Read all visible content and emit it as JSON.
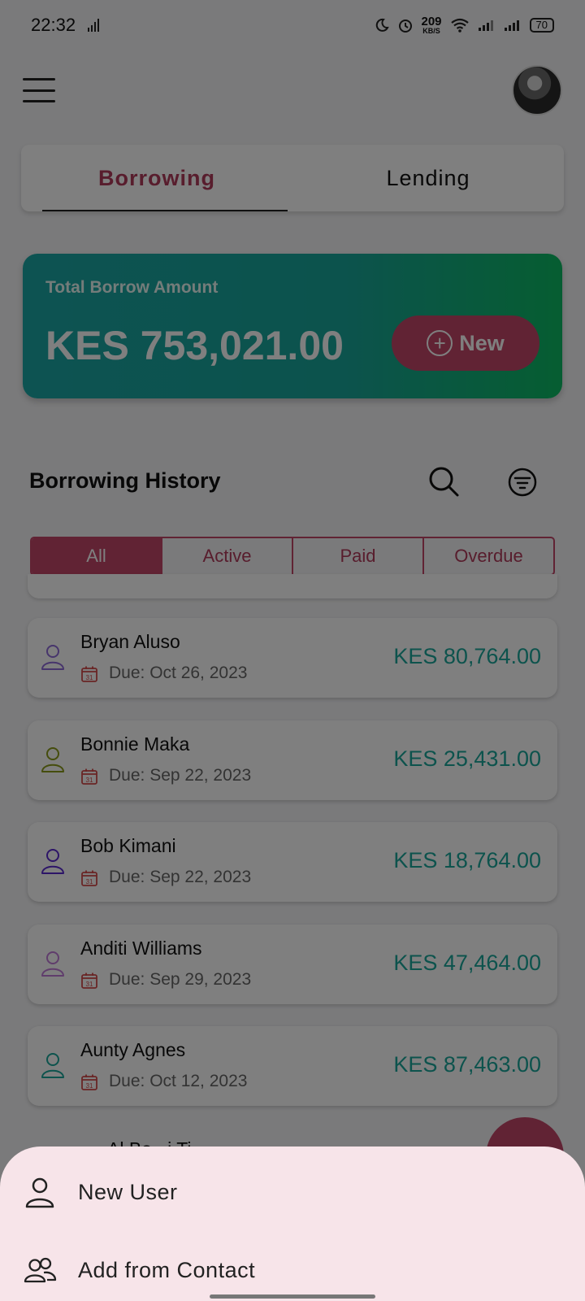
{
  "status_bar": {
    "time": "22:32",
    "network_speed_value": "209",
    "network_speed_unit": "KB/S",
    "battery": "70"
  },
  "tabs": [
    {
      "label": "Borrowing",
      "active": true
    },
    {
      "label": "Lending",
      "active": false
    }
  ],
  "summary": {
    "label": "Total Borrow Amount",
    "amount": "KES 753,021.00",
    "new_button": "New",
    "gradient_start": "#1aa7a5",
    "gradient_end": "#0cbb63"
  },
  "history": {
    "title": "Borrowing History",
    "filters": [
      "All",
      "Active",
      "Paid",
      "Overdue"
    ],
    "selected_filter": "All",
    "items": [
      {
        "name": "Bryan Aluso",
        "due": "Due: Oct 26, 2023",
        "amount": "KES 80,764.00",
        "icon_color": "#8e6bd8"
      },
      {
        "name": "Bonnie Maka",
        "due": "Due: Sep 22, 2023",
        "amount": "KES 25,431.00",
        "icon_color": "#8a9a1a"
      },
      {
        "name": "Bob Kimani",
        "due": "Due: Sep 22, 2023",
        "amount": "KES 18,764.00",
        "icon_color": "#5a2ad0"
      },
      {
        "name": "Anditi Williams",
        "due": "Due: Sep 29, 2023",
        "amount": "KES 47,464.00",
        "icon_color": "#c07ad8"
      },
      {
        "name": "Aunty Agnes",
        "due": "Due: Oct 12, 2023",
        "amount": "KES 87,463.00",
        "icon_color": "#1aa79a"
      }
    ],
    "partial_next_name": "Al Bo...i Ti..."
  },
  "bottom_sheet": {
    "options": [
      {
        "label": "New User",
        "icon": "person-icon"
      },
      {
        "label": "Add from Contact",
        "icon": "contacts-icon"
      }
    ]
  },
  "colors": {
    "accent": "#c24668",
    "amount": "#1aa79a"
  }
}
